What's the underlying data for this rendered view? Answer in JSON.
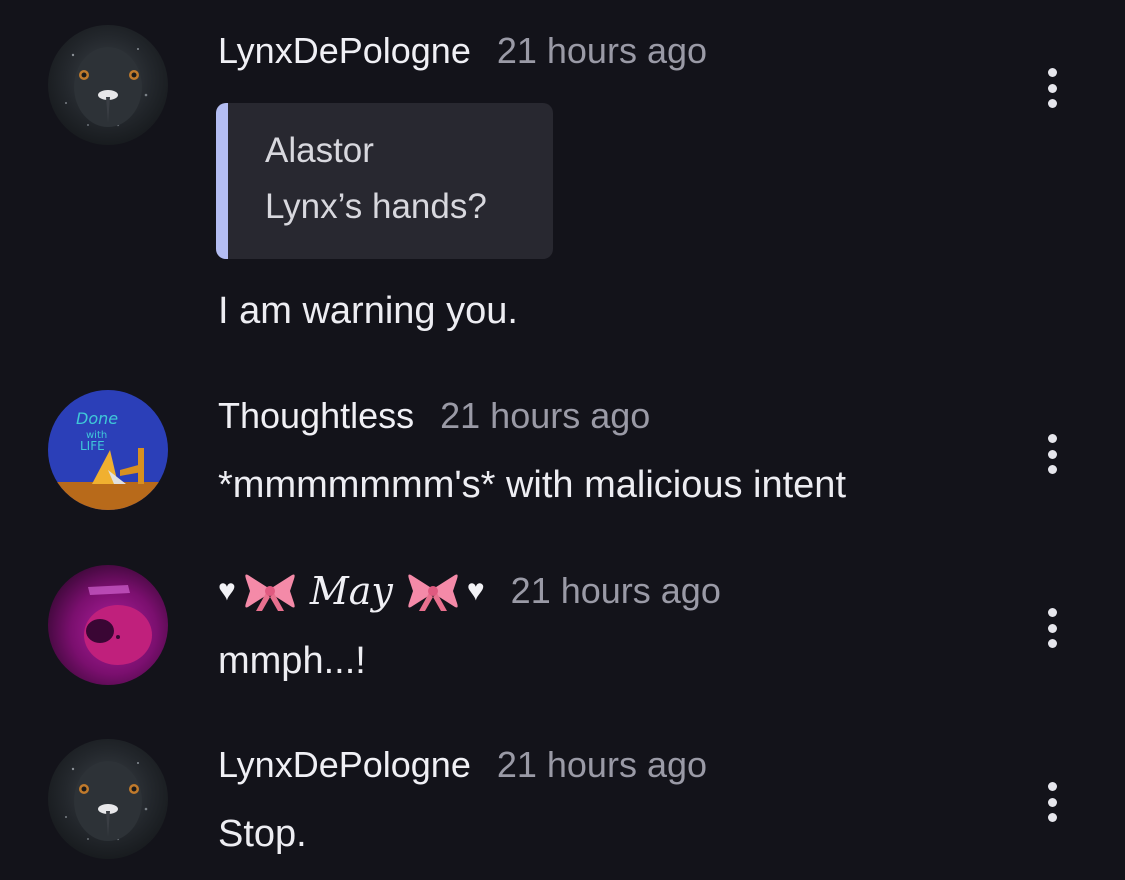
{
  "colors": {
    "background": "#13131a",
    "quote_bar": "#b4bdf2",
    "quote_background": "#282830",
    "timestamp": "#9a9aa6",
    "bow": "#f48aa8"
  },
  "comments": [
    {
      "username": "LynxDePologne",
      "timestamp": "21 hours ago",
      "quote": {
        "author": "Alastor",
        "text": "Lynx’s hands?"
      },
      "text": "I am warning you.",
      "avatar_icon": "pigeon-avatar-icon",
      "menu_icon": "more-vertical-icon"
    },
    {
      "username": "Thoughtless",
      "timestamp": "21 hours ago",
      "text": "*mmmmmmm's* with malicious intent",
      "avatar_icon": "done-with-life-avatar-icon",
      "avatar_text": [
        "Done",
        "with",
        "LIFE"
      ],
      "menu_icon": "more-vertical-icon"
    },
    {
      "username": "May",
      "username_decorations": [
        "heart-icon",
        "bow-icon",
        "bow-icon",
        "heart-icon"
      ],
      "heart_glyph": "♥",
      "timestamp": "21 hours ago",
      "text": "mmph...!",
      "avatar_icon": "magenta-photo-avatar-icon",
      "menu_icon": "more-vertical-icon"
    },
    {
      "username": "LynxDePologne",
      "timestamp": "21 hours ago",
      "text": "Stop.",
      "avatar_icon": "pigeon-avatar-icon",
      "menu_icon": "more-vertical-icon"
    }
  ]
}
